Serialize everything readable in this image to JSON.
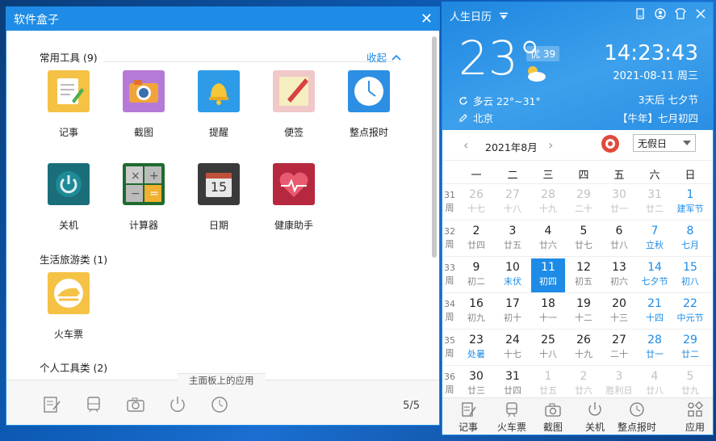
{
  "softbox": {
    "title": "软件盒子",
    "section_common": "常用工具 (9)",
    "collapse_label": "收起",
    "section_travel": "生活旅游类 (1)",
    "section_personal": "个人工具类 (2)",
    "apps": [
      {
        "label": "记事"
      },
      {
        "label": "截图"
      },
      {
        "label": "提醒"
      },
      {
        "label": "便签"
      },
      {
        "label": "整点报时"
      },
      {
        "label": "关机"
      },
      {
        "label": "计算器"
      },
      {
        "label": "日期"
      },
      {
        "label": "健康助手"
      }
    ],
    "travel_app": {
      "label": "火车票"
    },
    "calendar_day_num": "15",
    "bottom_tag": "主面板上的应用",
    "pager": "5/5"
  },
  "calendar": {
    "app_title": "人生日历",
    "temperature": "23°",
    "aqi": "优 39",
    "time": "14:23:43",
    "date": "2021-08-11 周三",
    "weather": "多云 22°~31°",
    "city": "北京",
    "countdown": "3天后 七夕节",
    "lunar": "【牛年】七月初四",
    "month_label": "2021年8月",
    "holiday_select": "无假日",
    "weekdays": [
      "一",
      "二",
      "三",
      "四",
      "五",
      "六",
      "日"
    ],
    "week_suffix": "周",
    "rows": [
      {
        "wk": "31",
        "days": [
          {
            "n": "26",
            "l": "十七",
            "out": true
          },
          {
            "n": "27",
            "l": "十八",
            "out": true
          },
          {
            "n": "28",
            "l": "十九",
            "out": true
          },
          {
            "n": "29",
            "l": "二十",
            "out": true
          },
          {
            "n": "30",
            "l": "廿一",
            "out": true
          },
          {
            "n": "31",
            "l": "廿二",
            "out": true
          },
          {
            "n": "1",
            "l": "建军节",
            "we": true,
            "hl": true
          }
        ]
      },
      {
        "wk": "32",
        "days": [
          {
            "n": "2",
            "l": "廿四"
          },
          {
            "n": "3",
            "l": "廿五"
          },
          {
            "n": "4",
            "l": "廿六"
          },
          {
            "n": "5",
            "l": "廿七"
          },
          {
            "n": "6",
            "l": "廿八"
          },
          {
            "n": "7",
            "l": "立秋",
            "we": true,
            "hl": true
          },
          {
            "n": "8",
            "l": "七月",
            "we": true,
            "hl": true
          }
        ]
      },
      {
        "wk": "33",
        "days": [
          {
            "n": "9",
            "l": "初二"
          },
          {
            "n": "10",
            "l": "末伏",
            "hl": true
          },
          {
            "n": "11",
            "l": "初四",
            "today": true
          },
          {
            "n": "12",
            "l": "初五"
          },
          {
            "n": "13",
            "l": "初六"
          },
          {
            "n": "14",
            "l": "七夕节",
            "we": true,
            "hl": true
          },
          {
            "n": "15",
            "l": "初八",
            "we": true,
            "hl": true
          }
        ]
      },
      {
        "wk": "34",
        "days": [
          {
            "n": "16",
            "l": "初九"
          },
          {
            "n": "17",
            "l": "初十"
          },
          {
            "n": "18",
            "l": "十一"
          },
          {
            "n": "19",
            "l": "十二"
          },
          {
            "n": "20",
            "l": "十三"
          },
          {
            "n": "21",
            "l": "十四",
            "we": true,
            "hl": true
          },
          {
            "n": "22",
            "l": "中元节",
            "we": true,
            "hl": true
          }
        ]
      },
      {
        "wk": "35",
        "days": [
          {
            "n": "23",
            "l": "处暑",
            "hl": true
          },
          {
            "n": "24",
            "l": "十七"
          },
          {
            "n": "25",
            "l": "十八"
          },
          {
            "n": "26",
            "l": "十九"
          },
          {
            "n": "27",
            "l": "二十"
          },
          {
            "n": "28",
            "l": "廿一",
            "we": true,
            "hl": true
          },
          {
            "n": "29",
            "l": "廿二",
            "we": true,
            "hl": true
          }
        ]
      },
      {
        "wk": "36",
        "days": [
          {
            "n": "30",
            "l": "廿三"
          },
          {
            "n": "31",
            "l": "廿四"
          },
          {
            "n": "1",
            "l": "廿五",
            "out": true
          },
          {
            "n": "2",
            "l": "廿六",
            "out": true
          },
          {
            "n": "3",
            "l": "胜利日",
            "out": true
          },
          {
            "n": "4",
            "l": "廿八",
            "out": true
          },
          {
            "n": "5",
            "l": "廿九",
            "out": true
          }
        ]
      }
    ],
    "bottom_apps": [
      {
        "label": "记事",
        "icon": "notepad-icon"
      },
      {
        "label": "火车票",
        "icon": "train-icon"
      },
      {
        "label": "截图",
        "icon": "camera-icon"
      },
      {
        "label": "关机",
        "icon": "power-icon"
      },
      {
        "label": "整点报时",
        "icon": "clock-icon"
      },
      {
        "label": "应用",
        "icon": "apps-grid-icon"
      }
    ]
  }
}
